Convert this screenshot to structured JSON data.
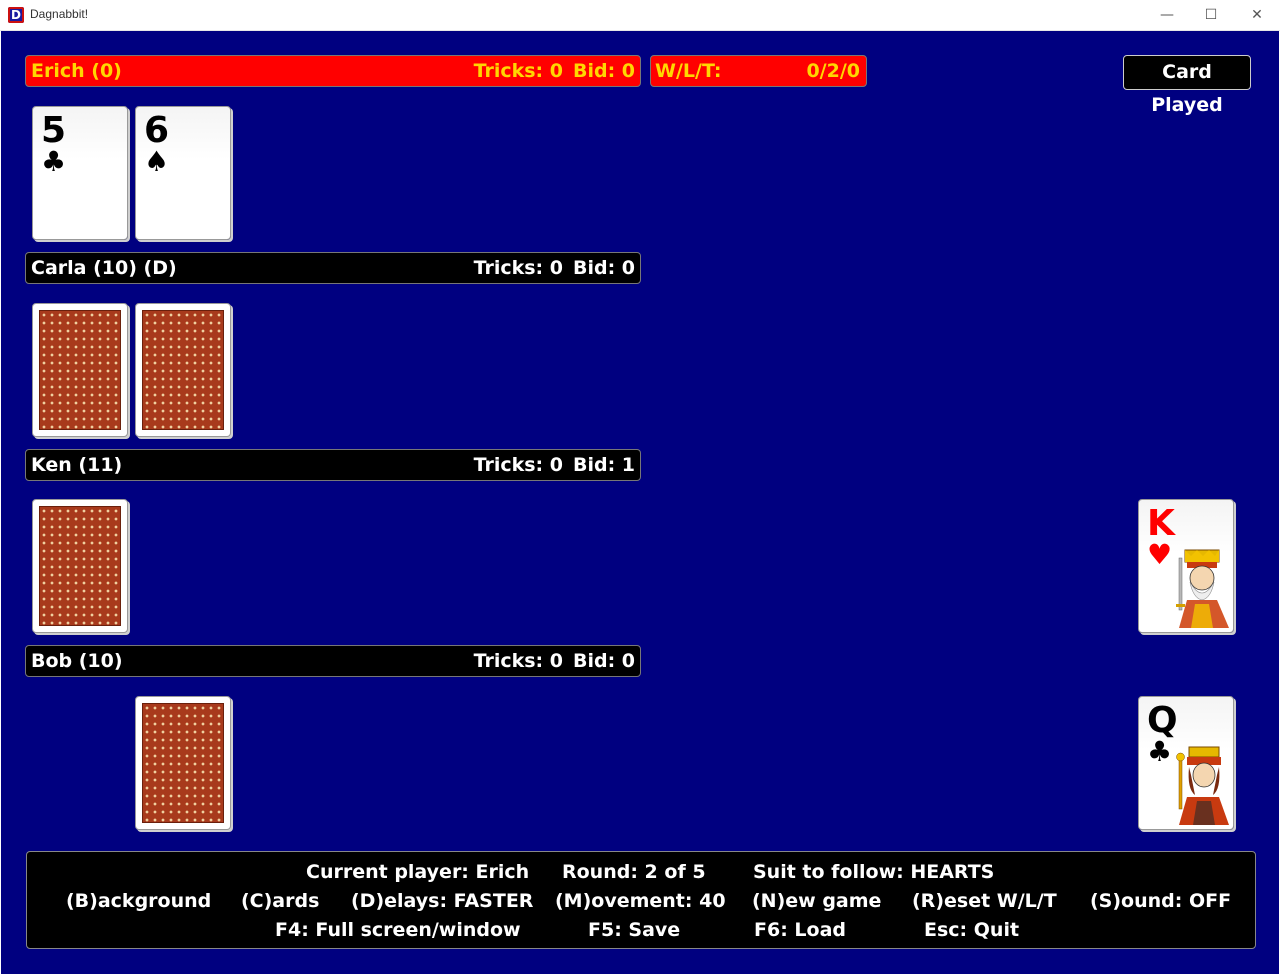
{
  "window": {
    "title": "Dagnabbit!",
    "icon_letter": "D",
    "minimize": "—",
    "maximize": "☐",
    "close": "✕"
  },
  "players": [
    {
      "name": "Erich (0)",
      "tricks": "Tricks: 0",
      "bid": "Bid: 0",
      "current": true
    },
    {
      "name": "Carla (10) (D)",
      "tricks": "Tricks: 0",
      "bid": "Bid: 0",
      "current": false
    },
    {
      "name": "Ken (11)",
      "tricks": "Tricks: 0",
      "bid": "Bid: 1",
      "current": false
    },
    {
      "name": "Bob (10)",
      "tricks": "Tricks: 0",
      "bid": "Bid: 0",
      "current": false
    }
  ],
  "wlt": {
    "label": "W/L/T:",
    "value": "0/2/0"
  },
  "card_played_label": "Card Played",
  "hands": {
    "erich": [
      {
        "rank": "5",
        "suit": "♣",
        "color": "#000000"
      },
      {
        "rank": "6",
        "suit": "♠",
        "color": "#000000"
      }
    ],
    "carla_back_count": 2,
    "ken_back_count": 1,
    "bob_back_count": 1
  },
  "played_cards": [
    {
      "rank": "K",
      "suit": "♥",
      "color": "#ff0000",
      "court_icon": "king-of-hearts-icon"
    },
    {
      "rank": "Q",
      "suit": "♣",
      "color": "#000000",
      "court_icon": "queen-of-clubs-icon"
    }
  ],
  "status": {
    "current_player": "Current player: Erich",
    "round": "Round: 2 of 5",
    "suit_to_follow": "Suit to follow: HEARTS",
    "background": "(B)ackground",
    "cards": "(C)ards",
    "delays": "(D)elays: FASTER",
    "movement": "(M)ovement: 40",
    "new_game": "(N)ew game",
    "reset": "(R)eset W/L/T",
    "sound": "(S)ound: OFF",
    "fullscreen": "F4: Full screen/window",
    "save": "F5: Save",
    "load": "F6: Load",
    "quit": "Esc: Quit"
  },
  "colors": {
    "table": "#000080",
    "current_bar": "#ff0000",
    "current_text": "#ffd700",
    "card_back": "#a83a1c"
  }
}
